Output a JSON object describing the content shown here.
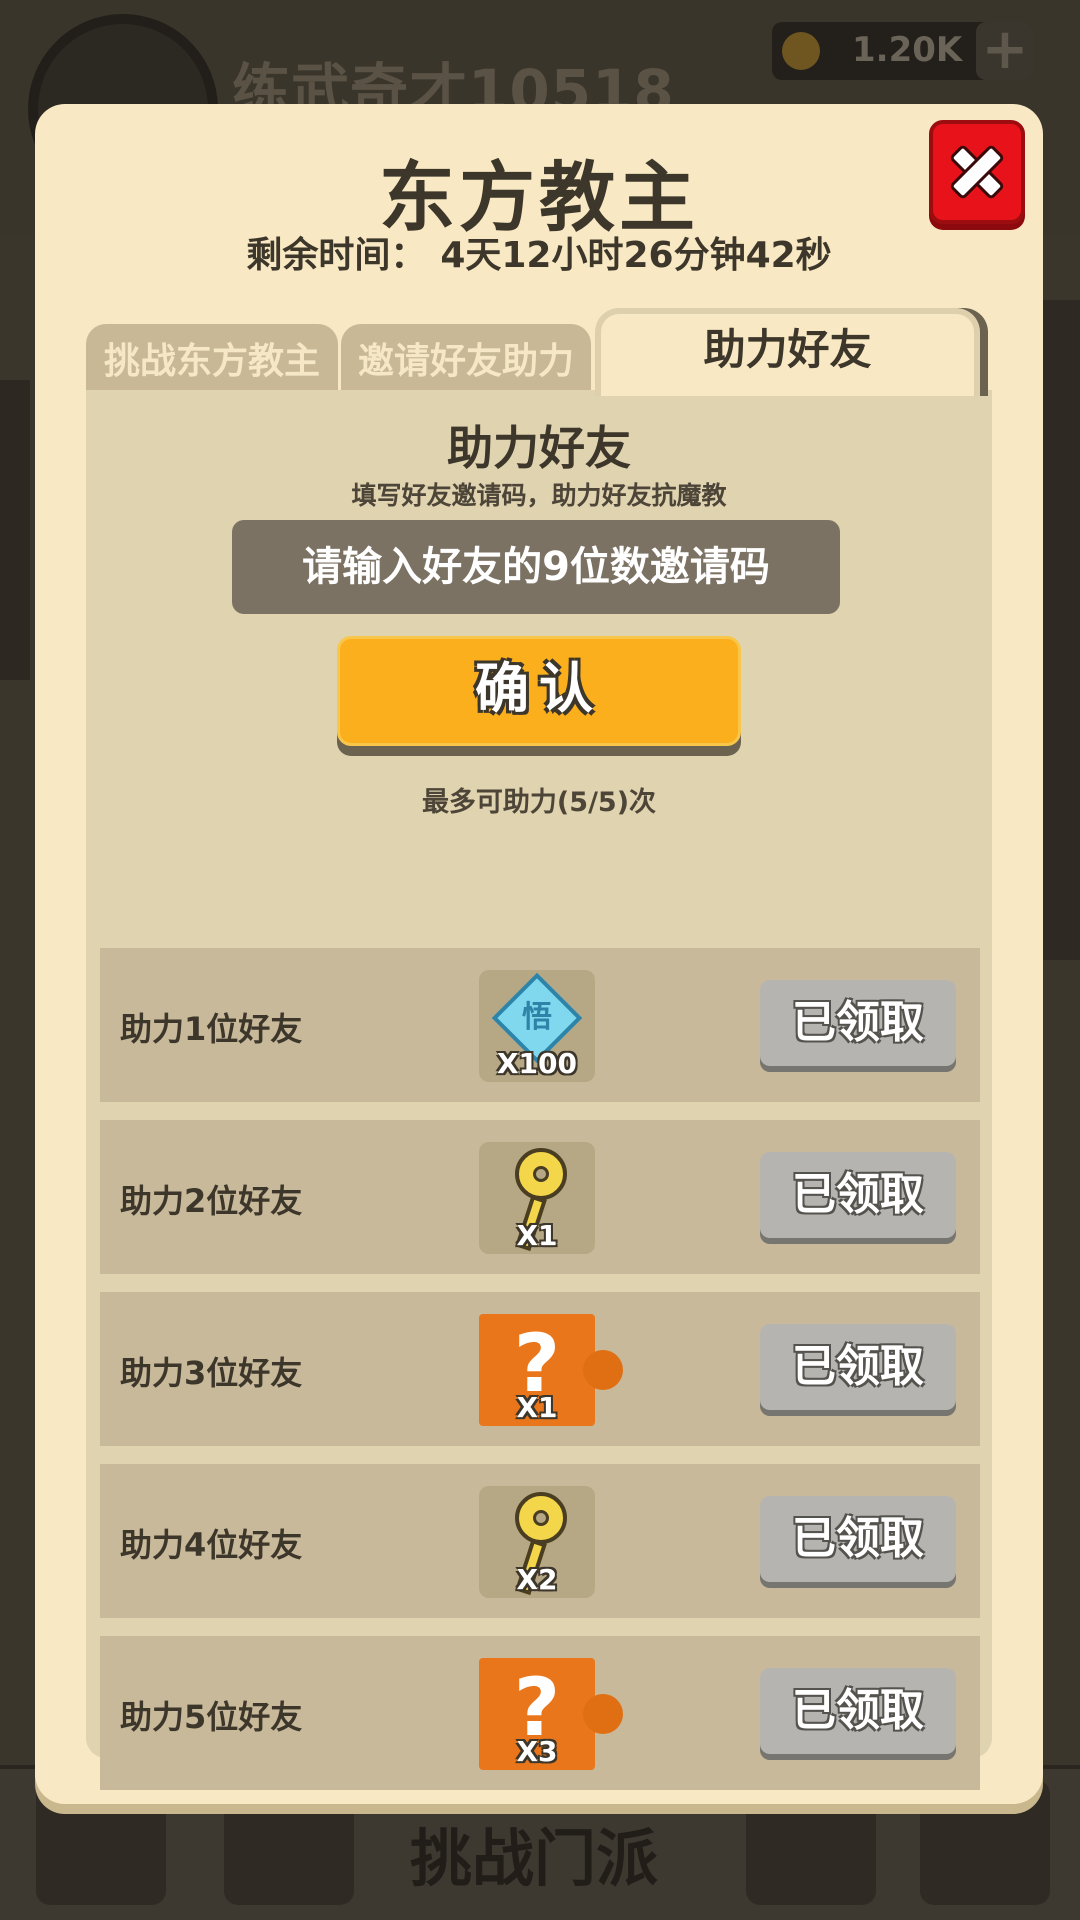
{
  "background": {
    "player_name": "练武奇才10518",
    "currency_value": "1.20K",
    "currency_plus": "+",
    "bottom_center_label": "挑战门派"
  },
  "modal": {
    "title": "东方教主",
    "timer_label": "剩余时间：",
    "timer_value": "4天12小时26分钟42秒",
    "tabs": [
      {
        "label": "挑战东方教主",
        "active": false
      },
      {
        "label": "邀请好友助力",
        "active": false
      },
      {
        "label": "助力好友",
        "active": true
      }
    ],
    "panel": {
      "title": "助力好友",
      "subtitle": "填写好友邀请码，助力好友抗魔教",
      "input_value": "",
      "input_placeholder": "请输入好友的9位数邀请码",
      "confirm_label": "确认",
      "limit_text": "最多可助力(5/5)次"
    },
    "rewards": [
      {
        "label": "助力1位好友",
        "icon": "diamond-icon",
        "icon_char": "悟",
        "qty": "X100",
        "status": "已领取"
      },
      {
        "label": "助力2位好友",
        "icon": "key-icon",
        "qty": "X1",
        "status": "已领取"
      },
      {
        "label": "助力3位好友",
        "icon": "puzzle-question-icon",
        "icon_char": "?",
        "qty": "X1",
        "status": "已领取"
      },
      {
        "label": "助力4位好友",
        "icon": "key-icon",
        "qty": "X2",
        "status": "已领取"
      },
      {
        "label": "助力5位好友",
        "icon": "puzzle-question-icon",
        "icon_char": "?",
        "qty": "X3",
        "status": "已领取"
      }
    ]
  },
  "colors": {
    "modal_bg": "#f8e8c3",
    "panel_bg": "#e0d3b0",
    "row_bg": "#c8b99a",
    "confirm": "#fbaf1d",
    "close": "#e8131a",
    "claimed": "#b5b4b0"
  }
}
